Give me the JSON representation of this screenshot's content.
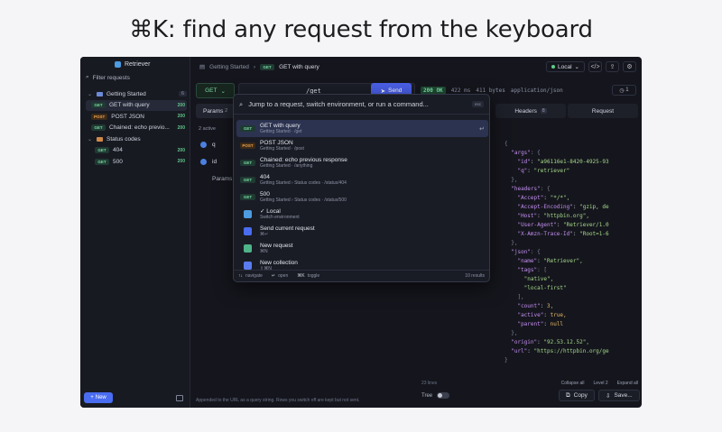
{
  "headline": "⌘K: find any request from the keyboard",
  "sidebar": {
    "app_name": "Retriever",
    "filter_placeholder": "Filter requests",
    "folders": [
      {
        "name": "Getting Started",
        "count": "6"
      },
      {
        "name": "Status codes"
      }
    ],
    "requests": [
      {
        "method": "GET",
        "name": "GET with query",
        "status": "200"
      },
      {
        "method": "POST",
        "name": "POST JSON",
        "status": "200"
      },
      {
        "method": "GET",
        "name": "Chained: echo previo...",
        "status": "200"
      },
      {
        "method": "GET",
        "name": "404",
        "status": "200"
      },
      {
        "method": "GET",
        "name": "500",
        "status": "200"
      }
    ],
    "new_label": "New"
  },
  "breadcrumb": {
    "folder": "Getting Started",
    "method": "GET",
    "name": "GET with query"
  },
  "topbar": {
    "env": "Local"
  },
  "request": {
    "method": "GET",
    "url": "/get",
    "send_label": "Send"
  },
  "response": {
    "status": "200 OK",
    "time": "422 ms",
    "size": "411 bytes",
    "type": "application/json",
    "history": "1"
  },
  "left_pane": {
    "tab": "Params",
    "tab_count": "2",
    "meta": "2 active",
    "params": [
      "q",
      "id"
    ],
    "footer": "Params",
    "hint": "Appended to the URL as a query string. Rows you switch off are kept but not sent."
  },
  "right_pane": {
    "tabs": [
      {
        "label": "Headers",
        "count": "8"
      },
      {
        "label": "Request"
      }
    ],
    "lines_count": "23 lines",
    "collapse_all": "Collapse all",
    "level": "Level 2",
    "expand_all": "Expand all",
    "tree_label": "Tree",
    "copy_label": "Copy",
    "save_label": "Save..."
  },
  "json_lines": [
    [
      "p",
      "{"
    ],
    [
      "kv",
      "\"args\"",
      ": {"
    ],
    [
      "kv2",
      "\"id\"",
      "\"a96116e1-8420-4925-93"
    ],
    [
      "kv2",
      "\"q\"",
      "\"retriever\""
    ],
    [
      "p",
      "  },"
    ],
    [
      "kv",
      "\"headers\"",
      ": {"
    ],
    [
      "kv2",
      "\"Accept\"",
      "\"*/*\","
    ],
    [
      "kv2",
      "\"Accept-Encoding\"",
      "\"gzip, de"
    ],
    [
      "kv2",
      "\"Host\"",
      "\"httpbin.org\","
    ],
    [
      "kv2",
      "\"User-Agent\"",
      "\"Retriever/1.0"
    ],
    [
      "kv2",
      "\"X-Amzn-Trace-Id\"",
      "\"Root=1-6"
    ],
    [
      "p",
      "  },"
    ],
    [
      "kv",
      "\"json\"",
      ": {"
    ],
    [
      "kv2",
      "\"name\"",
      "\"Retriever\","
    ],
    [
      "kv",
      "  \"tags\"",
      ": ["
    ],
    [
      "s",
      "      \"native\","
    ],
    [
      "s",
      "      \"local-first\""
    ],
    [
      "p",
      "    ],"
    ],
    [
      "kvn",
      "\"count\"",
      "3,"
    ],
    [
      "kvn",
      "\"active\"",
      "true,"
    ],
    [
      "kvn",
      "\"parent\"",
      "null"
    ],
    [
      "p",
      "  },"
    ],
    [
      "kv1",
      "\"origin\"",
      "\"92.53.12.52\","
    ],
    [
      "kv1",
      "\"url\"",
      "\"https://httpbin.org/ge"
    ],
    [
      "p",
      "}"
    ]
  ],
  "palette": {
    "placeholder": "Jump to a request, switch environment, or run a command...",
    "esc": "esc",
    "items": [
      {
        "kind": "req",
        "method": "GET",
        "title": "GET with query",
        "sub": "Getting Started  ·  /get"
      },
      {
        "kind": "req",
        "method": "POST",
        "title": "POST JSON",
        "sub": "Getting Started  ·  /post"
      },
      {
        "kind": "req",
        "method": "GET",
        "title": "Chained: echo previous response",
        "sub": "Getting Started  ·  /anything"
      },
      {
        "kind": "req",
        "method": "GET",
        "title": "404",
        "sub": "Getting Started › Status codes  ·  /status/404"
      },
      {
        "kind": "req",
        "method": "GET",
        "title": "500",
        "sub": "Getting Started › Status codes  ·  /status/500"
      },
      {
        "kind": "cmd",
        "icon_color": "#4d9be0",
        "title": "✓ Local",
        "sub": "Switch environment"
      },
      {
        "kind": "cmd",
        "icon_color": "#4a6cf0",
        "title": "Send current request",
        "sub": "⌘↵"
      },
      {
        "kind": "cmd",
        "icon_color": "#4fb38a",
        "title": "New request",
        "sub": "⌘N"
      },
      {
        "kind": "cmd",
        "icon_color": "#5a7cf0",
        "title": "New collection",
        "sub": "⇧⌘N"
      }
    ],
    "foot": {
      "navigate": "navigate",
      "open": "open",
      "toggle": "toggle",
      "count": "10 results"
    }
  }
}
